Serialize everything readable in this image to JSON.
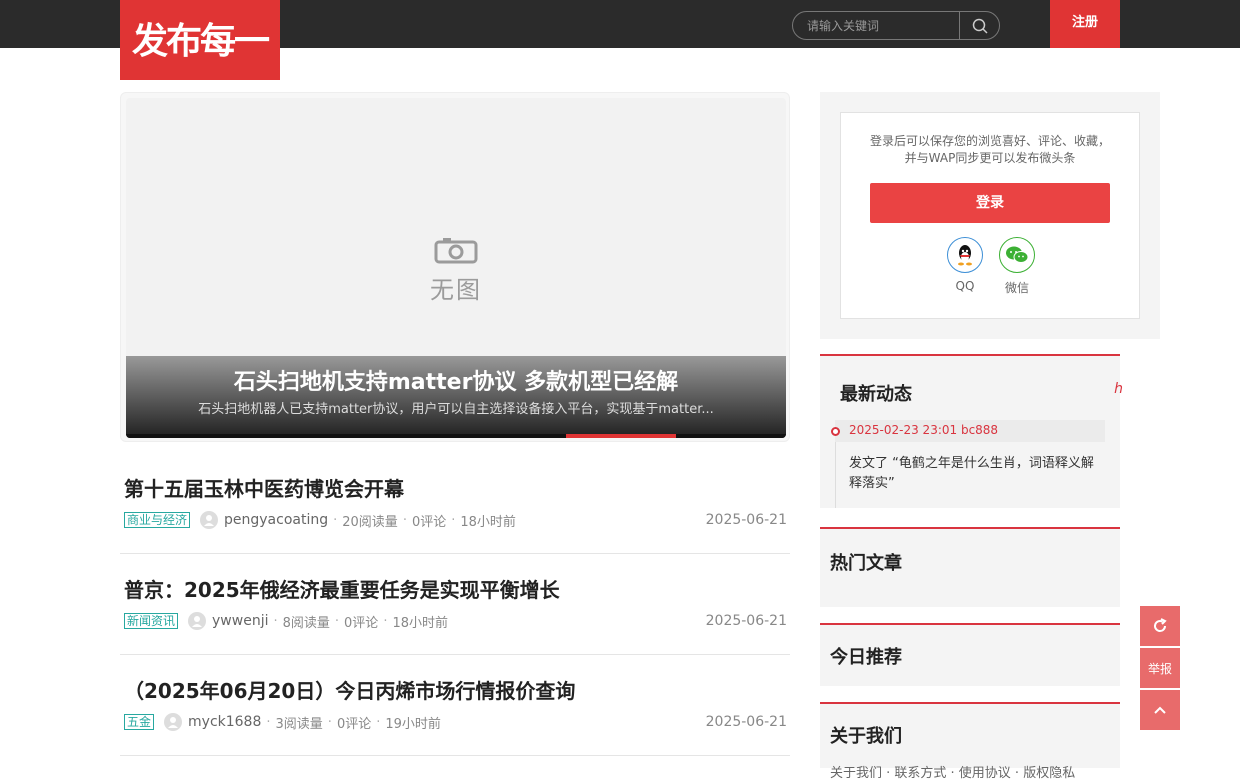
{
  "header": {
    "logo_text": "发布每一天",
    "search_placeholder": "请输入关键词",
    "register_label": "注册"
  },
  "slider": {
    "no_image_text": "无图",
    "title": "石头扫地机支持matter协议 多款机型已经解",
    "subtitle": "石头扫地机器人已支持matter协议，用户可以自主选择设备接入平台，实现基于matter..."
  },
  "articles": [
    {
      "title": "第十五届玉林中医药博览会开幕",
      "tag": "商业与经济",
      "author": "pengyacoating",
      "reads": "20阅读量",
      "comments": "0评论",
      "ago": "18小时前",
      "date": "2025-06-21"
    },
    {
      "title": "普京：2025年俄经济最重要任务是实现平衡增长",
      "tag": "新闻资讯",
      "author": "ywwenji",
      "reads": "8阅读量",
      "comments": "0评论",
      "ago": "18小时前",
      "date": "2025-06-21"
    },
    {
      "title": "（2025年06月20日）今日丙烯市场行情报价查询",
      "tag": "五金",
      "author": "myck1688",
      "reads": "3阅读量",
      "comments": "0评论",
      "ago": "19小时前",
      "date": "2025-06-21"
    }
  ],
  "sidebar": {
    "login_message_line1": "登录后可以保存您的浏览喜好、评论、收藏，",
    "login_message_line2": "并与WAP同步更可以发布微头条",
    "login_button": "登录",
    "qq_label": "QQ",
    "wechat_label": "微信",
    "latest_title": "最新动态",
    "latest_more": "h",
    "latest_time": "2025-02-23 23:01 bc888",
    "latest_text": "发文了 “龟鹤之年是什么生肖，词语释义解释落实”",
    "hot_title": "热门文章",
    "recommend_title": "今日推荐",
    "about_title": "关于我们",
    "about_links": "关于我们 · 联系方式 · 使用协议 · 版权隐私"
  },
  "float": {
    "refresh_icon": "refresh-icon",
    "report_label": "举报",
    "top_icon": "chevron-up-icon"
  },
  "colors": {
    "brand_red": "#e03434",
    "tag_teal": "#27a8a0",
    "topbar": "#2b2b2b"
  }
}
